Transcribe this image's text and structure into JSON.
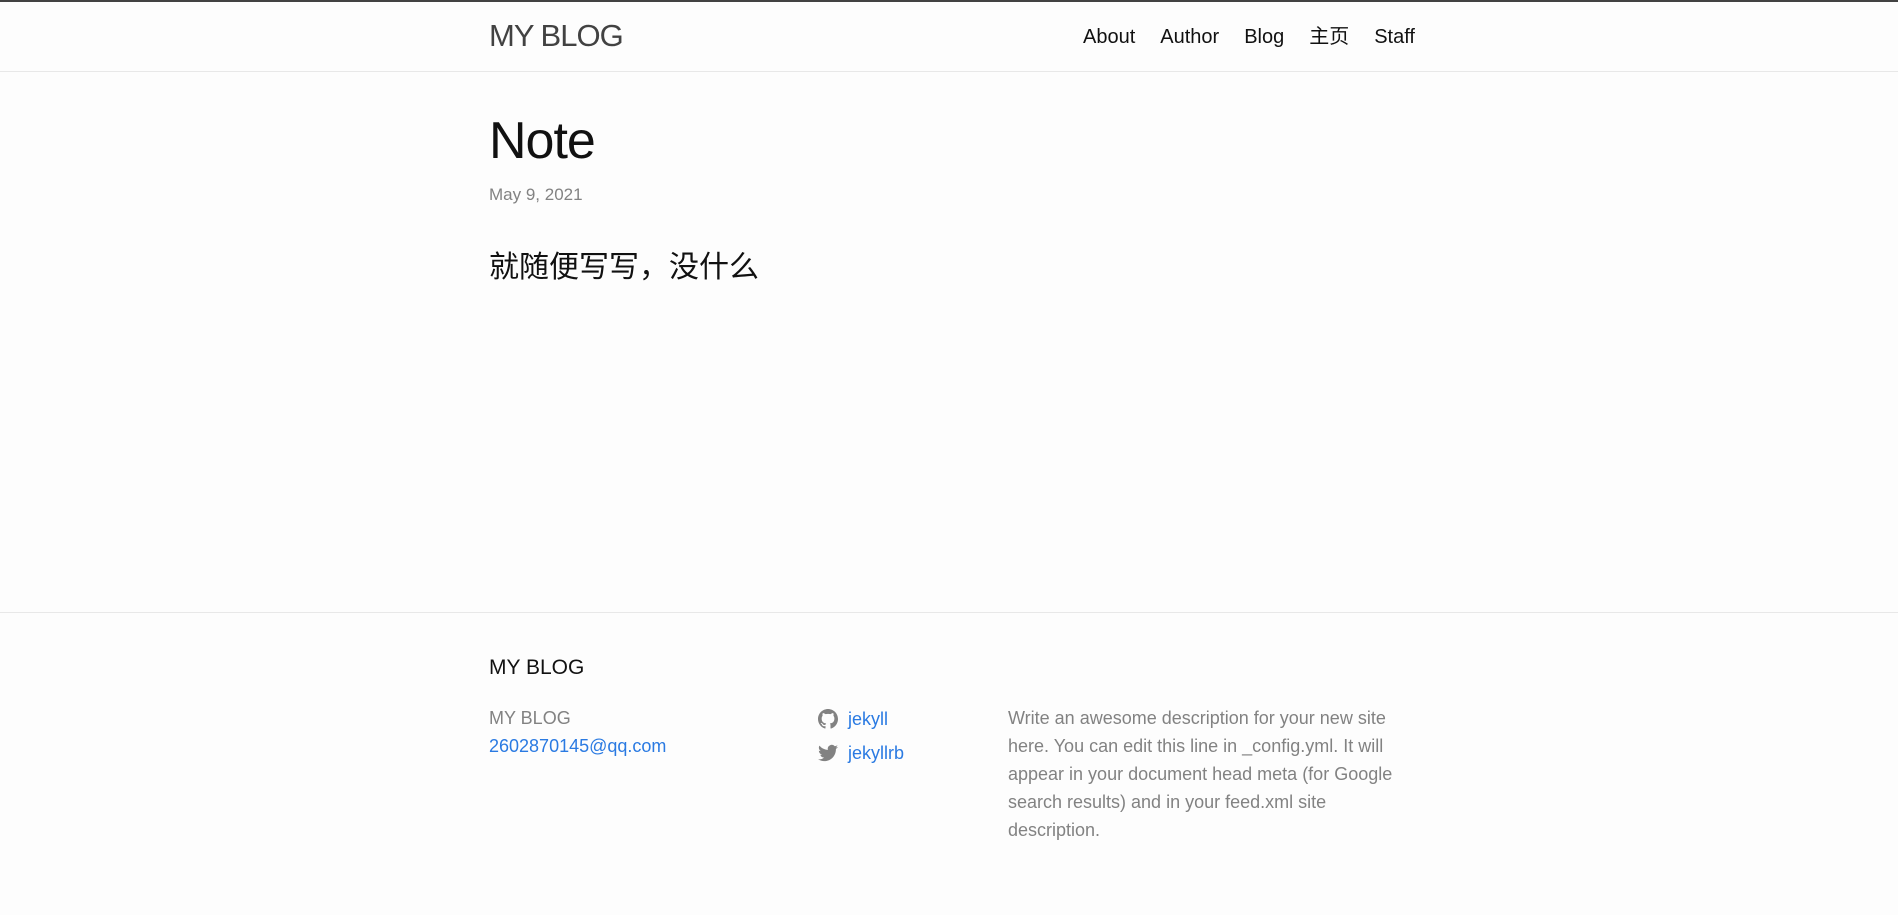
{
  "header": {
    "site_title": "MY BLOG",
    "nav": [
      "About",
      "Author",
      "Blog",
      "主页",
      "Staff"
    ]
  },
  "post": {
    "title": "Note",
    "date": "May 9, 2021",
    "content": "就随便写写，没什么"
  },
  "footer": {
    "heading": "MY BLOG",
    "name": "MY BLOG",
    "email": "2602870145@qq.com",
    "social": [
      {
        "icon": "github-icon",
        "label": "jekyll"
      },
      {
        "icon": "twitter-icon",
        "label": "jekyllrb"
      }
    ],
    "description": "Write an awesome description for your new site here. You can edit this line in _config.yml. It will appear in your document head meta (for Google search results) and in your feed.xml site description."
  },
  "colors": {
    "link": "#2a7ae2",
    "muted": "#828282",
    "text": "#111111",
    "border": "#e8e8e8"
  }
}
